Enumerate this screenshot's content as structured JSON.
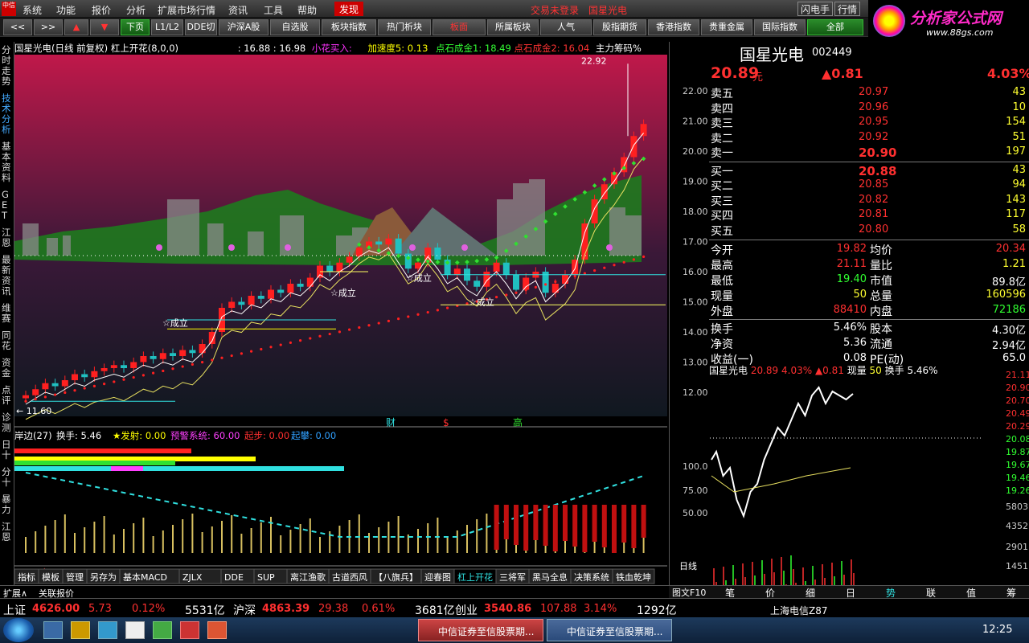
{
  "menu": {
    "items": [
      "系统",
      "功能",
      "报价",
      "分析",
      "扩展市场行情",
      "资讯",
      "工具",
      "帮助"
    ],
    "active": "发现",
    "login_status": "交易未登录",
    "window_title": "国星光电",
    "right_buttons": [
      "闪电手",
      "行情"
    ]
  },
  "toolbar": {
    "buttons": [
      "<<",
      ">>",
      "▲",
      "▼",
      "下页",
      "L1/L2",
      "DDE切",
      "沪深A股",
      "自选股",
      "板块指数",
      "热门析块",
      "板面",
      "所属板块",
      "人气",
      "股指期货",
      "香港指数",
      "贵重金属",
      "国际指数",
      "全部"
    ]
  },
  "logo": {
    "text": "分析家公式网",
    "url": "www.88gs.com"
  },
  "leftnav": {
    "items": [
      "分时走势",
      "技术分析",
      "基本资料",
      "GET",
      "江恩",
      "最新资讯",
      "维赛",
      "同花",
      "资金",
      "点评",
      "诊测",
      "日十",
      "分十",
      "暴力",
      "江恩"
    ]
  },
  "chart": {
    "header": {
      "title": "国星光电(日线 前复权) 杠上开花(8,0,0)",
      "v1": ": 16.88",
      "v2": ": 16.98",
      "xiaohua": "小花买入:",
      "jiasu": "加速度5: 0.13",
      "dian1": "点石成金1: 18.49",
      "dian2": "点石成金2: 16.04",
      "zhuli": "主力筹码%"
    },
    "high_label": "22.92",
    "low_label": "← 11.60",
    "price_axis": [
      "22.00",
      "21.00",
      "20.00",
      "19.00",
      "18.00",
      "17.00",
      "16.00",
      "15.00",
      "14.00",
      "13.00",
      "12.00"
    ],
    "markers": [
      "☆成立",
      "☆成立",
      "☆成立",
      "☆成立"
    ],
    "bottom_tags": [
      "财",
      "$",
      "高"
    ],
    "sub": {
      "title": "岸边(27)",
      "turnover": "换手: 5.46",
      "fashe": "★发射: 0.00",
      "yujing": "预警系统: 60.00",
      "qibu": "起步: 0.00",
      "qipan": "起攀: 0.00",
      "axis": [
        "100.0",
        "75.00",
        "50.00"
      ]
    },
    "date_axis": [
      "2015年",
      "3",
      "4",
      "5"
    ],
    "right_label": "日线"
  },
  "tabs": {
    "items": [
      "指标",
      "模板",
      "管理",
      "另存为",
      "基本MACD",
      "ZJLX",
      "DDE",
      "SUP",
      "离江渔歌",
      "古道西风",
      "【八旗兵】",
      "迎春图",
      "杠上开花",
      "三将军",
      "黑马全息",
      "决策系统",
      "铁血乾坤"
    ],
    "active": "杠上开花",
    "ext": [
      "扩展∧",
      "关联报价"
    ]
  },
  "stock": {
    "name": "国星光电",
    "code": "002449",
    "price": "20.89",
    "unit": "元",
    "change": "▲0.81",
    "pct": "4.03%",
    "sell": [
      {
        "label": "卖五",
        "price": "20.97",
        "vol": "43"
      },
      {
        "label": "卖四",
        "price": "20.96",
        "vol": "10"
      },
      {
        "label": "卖三",
        "price": "20.95",
        "vol": "154"
      },
      {
        "label": "卖二",
        "price": "20.92",
        "vol": "51"
      },
      {
        "label": "卖一",
        "price": "20.90",
        "vol": "197"
      }
    ],
    "buy": [
      {
        "label": "买一",
        "price": "20.88",
        "vol": "43"
      },
      {
        "label": "买二",
        "price": "20.85",
        "vol": "94"
      },
      {
        "label": "买三",
        "price": "20.82",
        "vol": "143"
      },
      {
        "label": "买四",
        "price": "20.81",
        "vol": "117"
      },
      {
        "label": "买五",
        "price": "20.80",
        "vol": "58"
      }
    ],
    "stats": [
      {
        "l1": "今开",
        "v1": "19.82",
        "l2": "均价",
        "v2": "20.34"
      },
      {
        "l1": "最高",
        "v1": "21.11",
        "l2": "量比",
        "v2": "1.21"
      },
      {
        "l1": "最低",
        "v1": "19.40",
        "l2": "市值",
        "v2": "89.8亿"
      },
      {
        "l1": "现量",
        "v1": "50",
        "l2": "总量",
        "v2": "160596"
      },
      {
        "l1": "外盘",
        "v1": "88410",
        "l2": "内盘",
        "v2": "72186"
      },
      {
        "l1": "换手",
        "v1": "5.46%",
        "l2": "股本",
        "v2": "4.30亿"
      },
      {
        "l1": "净资",
        "v1": "5.36",
        "l2": "流通",
        "v2": "2.94亿"
      },
      {
        "l1": "收益(一)",
        "v1": "0.08",
        "l2": "PE(动)",
        "v2": "65.0"
      }
    ],
    "mini_header": {
      "name": "国星光电",
      "price": "20.89",
      "pct": "4.03%",
      "chg": "▲0.81",
      "xl": "现量",
      "xlv": "50",
      "hs": "换手",
      "hsv": "5.46%"
    },
    "mini_axis": [
      "21.11",
      "20.90",
      "20.70",
      "20.49",
      "20.29",
      "20.08",
      "19.87",
      "19.67",
      "19.46",
      "19.26",
      "5803",
      "4352",
      "2901",
      "1451"
    ],
    "bottom_tabs": [
      "笔",
      "价",
      "细",
      "日",
      "势",
      "联",
      "值",
      "筹"
    ],
    "tuwen": "图文F10"
  },
  "status": {
    "items": [
      {
        "name": "上证",
        "v": "4626.00",
        "c": "5.73",
        "p": "0.12%",
        "amt": "5531亿"
      },
      {
        "name": "沪深",
        "v": "4863.39",
        "c": "29.38",
        "p": "0.61%",
        "amt": "3681亿"
      },
      {
        "name": "创业",
        "v": "3540.86",
        "c": "107.88",
        "p": "3.14%",
        "amt": "1292亿"
      }
    ],
    "server": "上海电信Z87"
  },
  "taskbar": {
    "apps": [
      "中信证券至信股票期...",
      "中信证券至信股票期..."
    ],
    "time": "12:25"
  },
  "colors": {
    "up": "#ff3030",
    "down": "#30ff30",
    "bg": "#000000",
    "accent": "#ffff00"
  }
}
